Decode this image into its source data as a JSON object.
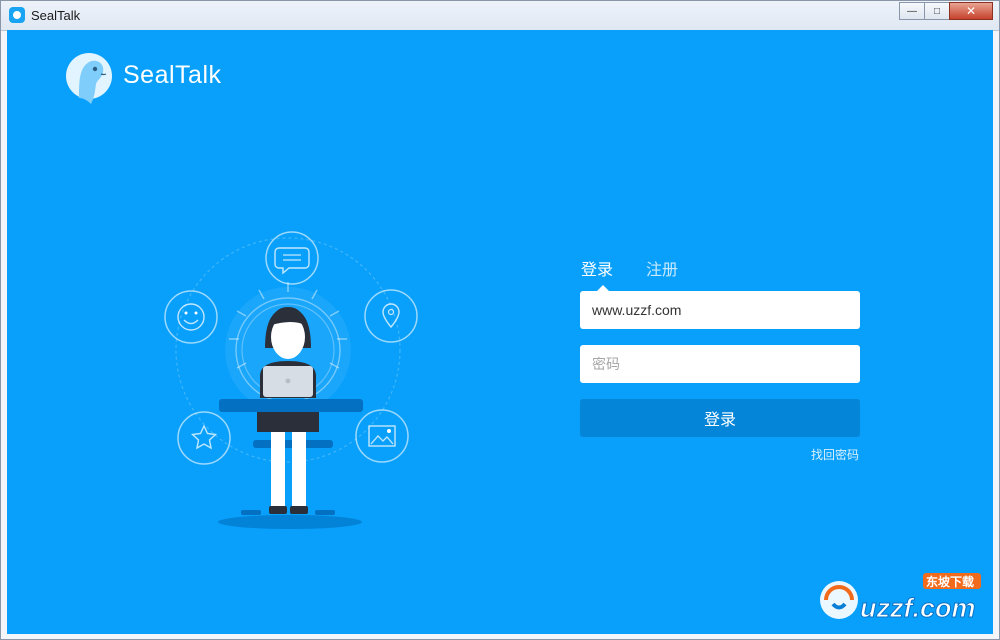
{
  "window": {
    "title": "SealTalk",
    "controls": {
      "minimize": "—",
      "maximize": "□",
      "close": "✕"
    }
  },
  "brand": {
    "name": "SealTalk",
    "logo_icon": "seal-logo-icon"
  },
  "login_form": {
    "tabs": [
      {
        "label": "登录",
        "active": true
      },
      {
        "label": "注册",
        "active": false
      }
    ],
    "account_value": "www.uzzf.com",
    "password_placeholder": "密码",
    "login_button": "登录",
    "forgot_password": "找回密码"
  },
  "illustration_icons": [
    "message-bubble-icon",
    "location-pin-icon",
    "image-icon",
    "star-icon",
    "smiley-icon"
  ],
  "watermark": {
    "text": "uzzf.com",
    "tag": "东坡下载"
  },
  "colors": {
    "background": "#09a0fb",
    "button": "#0485d8",
    "text": "#ffffff"
  }
}
